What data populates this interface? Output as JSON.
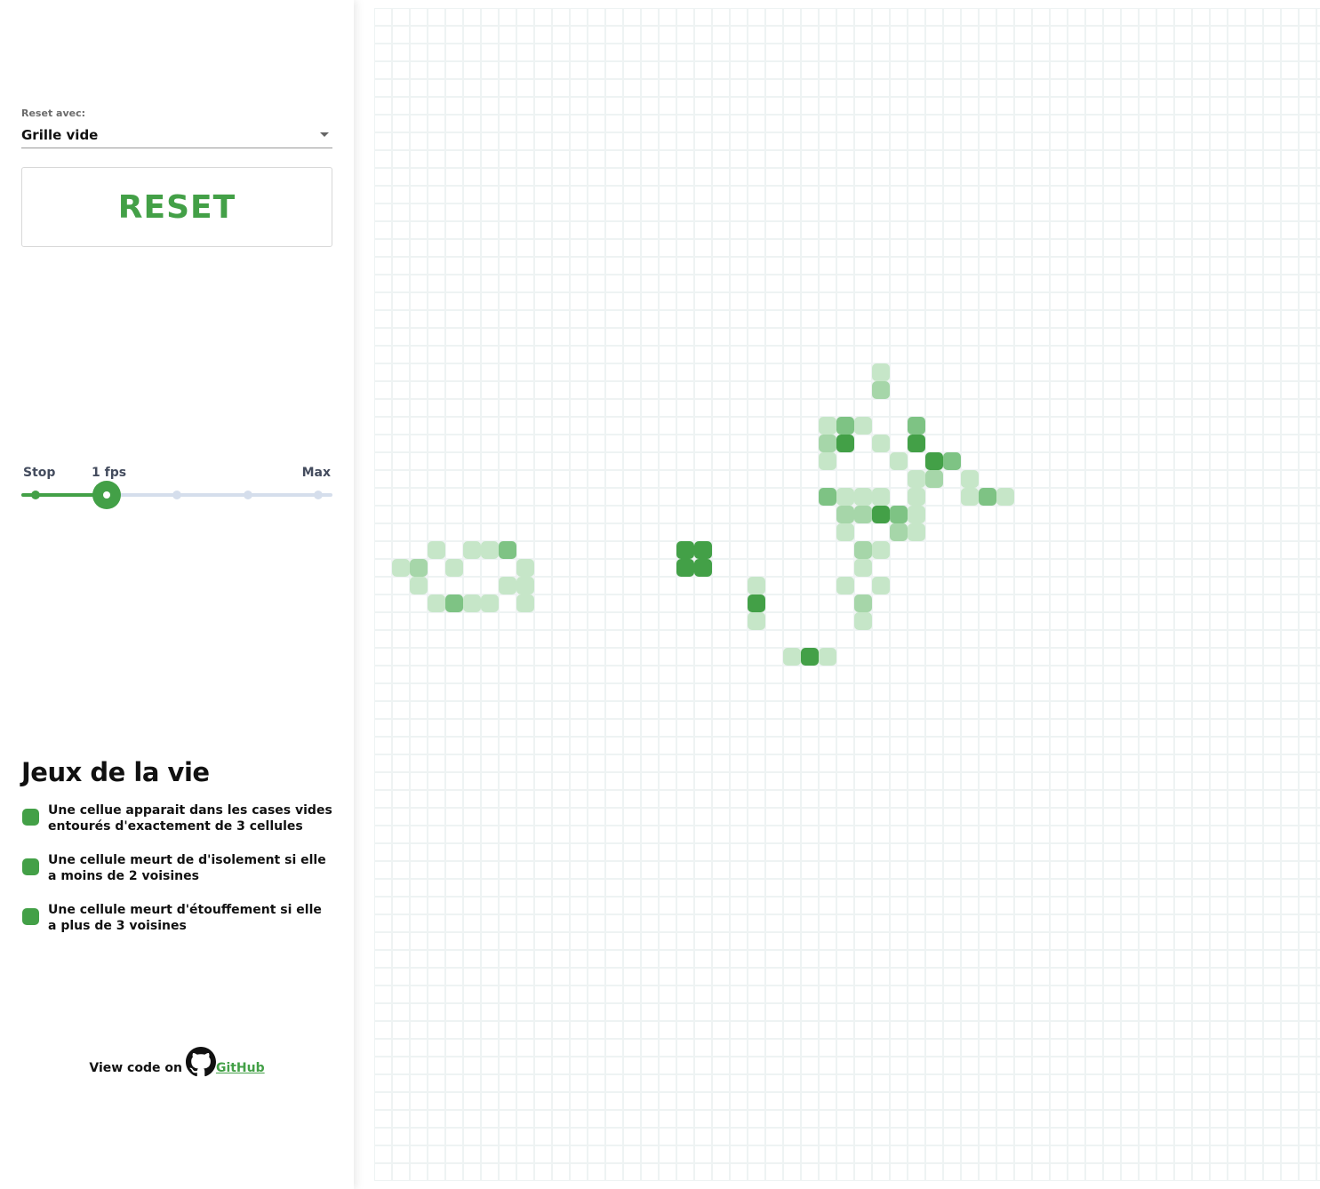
{
  "sidebar": {
    "reset_label": "Reset avec:",
    "select_value": "Grille vide",
    "reset_button": "RESET",
    "speed": {
      "labels": {
        "stop": "Stop",
        "current": "1 fps",
        "max": "Max"
      },
      "steps": 5,
      "value_index": 1
    },
    "title": "Jeux de la vie",
    "rules": [
      "Une cellue apparait dans les cases vides entourés d'exactement de 3 cellules",
      "Une cellule meurt de d'isolement si elle a moins de 2 voisines",
      "Une cellule meurt d'étouffement si elle a plus de 3 voisines"
    ],
    "footer": {
      "prefix": "View code on",
      "link": "GitHub"
    }
  },
  "colors": {
    "accent": "#43a047",
    "cell_alive": "#43a047",
    "cell_age_1": "#7ec384",
    "cell_age_2": "#a6d6a9",
    "cell_age_3": "#c6e6c8",
    "grid_line": "#eef3f3"
  },
  "board": {
    "columns": 54,
    "rows": 66,
    "cells": [
      {
        "c": 28,
        "r": 20,
        "s": 3
      },
      {
        "c": 28,
        "r": 21,
        "s": 2
      },
      {
        "c": 25,
        "r": 23,
        "s": 3
      },
      {
        "c": 26,
        "r": 23,
        "s": 1
      },
      {
        "c": 27,
        "r": 23,
        "s": 3
      },
      {
        "c": 30,
        "r": 23,
        "s": 1
      },
      {
        "c": 25,
        "r": 24,
        "s": 2
      },
      {
        "c": 26,
        "r": 24,
        "s": 0
      },
      {
        "c": 28,
        "r": 24,
        "s": 3
      },
      {
        "c": 30,
        "r": 24,
        "s": 0
      },
      {
        "c": 25,
        "r": 25,
        "s": 3
      },
      {
        "c": 29,
        "r": 25,
        "s": 3
      },
      {
        "c": 31,
        "r": 25,
        "s": 0
      },
      {
        "c": 32,
        "r": 25,
        "s": 1
      },
      {
        "c": 30,
        "r": 26,
        "s": 3
      },
      {
        "c": 31,
        "r": 26,
        "s": 2
      },
      {
        "c": 33,
        "r": 26,
        "s": 3
      },
      {
        "c": 25,
        "r": 27,
        "s": 1
      },
      {
        "c": 26,
        "r": 27,
        "s": 3
      },
      {
        "c": 27,
        "r": 27,
        "s": 3
      },
      {
        "c": 28,
        "r": 27,
        "s": 3
      },
      {
        "c": 30,
        "r": 27,
        "s": 3
      },
      {
        "c": 33,
        "r": 27,
        "s": 3
      },
      {
        "c": 34,
        "r": 27,
        "s": 1
      },
      {
        "c": 35,
        "r": 27,
        "s": 3
      },
      {
        "c": 26,
        "r": 28,
        "s": 2
      },
      {
        "c": 27,
        "r": 28,
        "s": 2
      },
      {
        "c": 28,
        "r": 28,
        "s": 0
      },
      {
        "c": 29,
        "r": 28,
        "s": 1
      },
      {
        "c": 30,
        "r": 28,
        "s": 3
      },
      {
        "c": 26,
        "r": 29,
        "s": 3
      },
      {
        "c": 29,
        "r": 29,
        "s": 2
      },
      {
        "c": 30,
        "r": 29,
        "s": 3
      },
      {
        "c": 27,
        "r": 30,
        "s": 2
      },
      {
        "c": 28,
        "r": 30,
        "s": 3
      },
      {
        "c": 27,
        "r": 31,
        "s": 3
      },
      {
        "c": 26,
        "r": 32,
        "s": 3
      },
      {
        "c": 28,
        "r": 32,
        "s": 3
      },
      {
        "c": 27,
        "r": 33,
        "s": 2
      },
      {
        "c": 27,
        "r": 34,
        "s": 3
      },
      {
        "c": 3,
        "r": 30,
        "s": 3
      },
      {
        "c": 5,
        "r": 30,
        "s": 3
      },
      {
        "c": 6,
        "r": 30,
        "s": 3
      },
      {
        "c": 7,
        "r": 30,
        "s": 1
      },
      {
        "c": 1,
        "r": 31,
        "s": 3
      },
      {
        "c": 2,
        "r": 31,
        "s": 2
      },
      {
        "c": 4,
        "r": 31,
        "s": 3
      },
      {
        "c": 8,
        "r": 31,
        "s": 3
      },
      {
        "c": 2,
        "r": 32,
        "s": 3
      },
      {
        "c": 7,
        "r": 32,
        "s": 3
      },
      {
        "c": 8,
        "r": 32,
        "s": 3
      },
      {
        "c": 3,
        "r": 33,
        "s": 3
      },
      {
        "c": 4,
        "r": 33,
        "s": 1
      },
      {
        "c": 5,
        "r": 33,
        "s": 3
      },
      {
        "c": 6,
        "r": 33,
        "s": 3
      },
      {
        "c": 8,
        "r": 33,
        "s": 3
      },
      {
        "c": 17,
        "r": 30,
        "s": 0
      },
      {
        "c": 18,
        "r": 30,
        "s": 0
      },
      {
        "c": 17,
        "r": 31,
        "s": 0
      },
      {
        "c": 18,
        "r": 31,
        "s": 0
      },
      {
        "c": 21,
        "r": 32,
        "s": 3
      },
      {
        "c": 21,
        "r": 33,
        "s": 0
      },
      {
        "c": 21,
        "r": 34,
        "s": 3
      },
      {
        "c": 23,
        "r": 36,
        "s": 3
      },
      {
        "c": 24,
        "r": 36,
        "s": 0
      },
      {
        "c": 25,
        "r": 36,
        "s": 3
      }
    ]
  }
}
